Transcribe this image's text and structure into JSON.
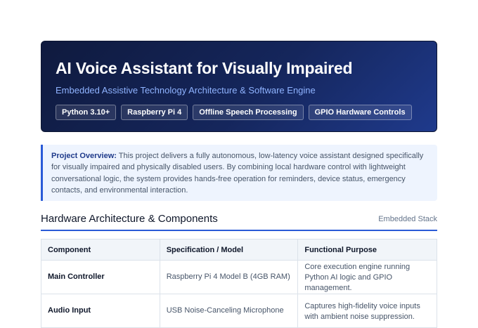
{
  "hero": {
    "title": "AI Voice Assistant for Visually Impaired",
    "subtitle": "Embedded Assistive Technology Architecture & Software Engine",
    "tags": [
      "Python 3.10+",
      "Raspberry Pi 4",
      "Offline Speech Processing",
      "GPIO Hardware Controls"
    ]
  },
  "overview": {
    "label": "Project Overview:",
    "text": "This project delivers a fully autonomous, low-latency voice assistant designed specifically for visually impaired and physically disabled users. By combining local hardware control with lightweight conversational logic, the system provides hands-free operation for reminders, device status, emergency contacts, and environmental interaction."
  },
  "section": {
    "title": "Hardware Architecture & Components",
    "meta": "Embedded Stack"
  },
  "table": {
    "headers": [
      "Component",
      "Specification / Model",
      "Functional Purpose"
    ],
    "rows": [
      [
        "Main Controller",
        "Raspberry Pi 4 Model B (4GB RAM)",
        "Core execution engine running Python AI logic and GPIO management."
      ],
      [
        "Audio Input",
        "USB Noise-Canceling Microphone",
        "Captures high-fidelity voice inputs with ambient noise suppression."
      ]
    ]
  },
  "colors": {
    "hero_background": "#15265c",
    "accent": "#2a5bd7",
    "subtitle": "#8fb3ff",
    "overview_background": "#eef4fe"
  }
}
